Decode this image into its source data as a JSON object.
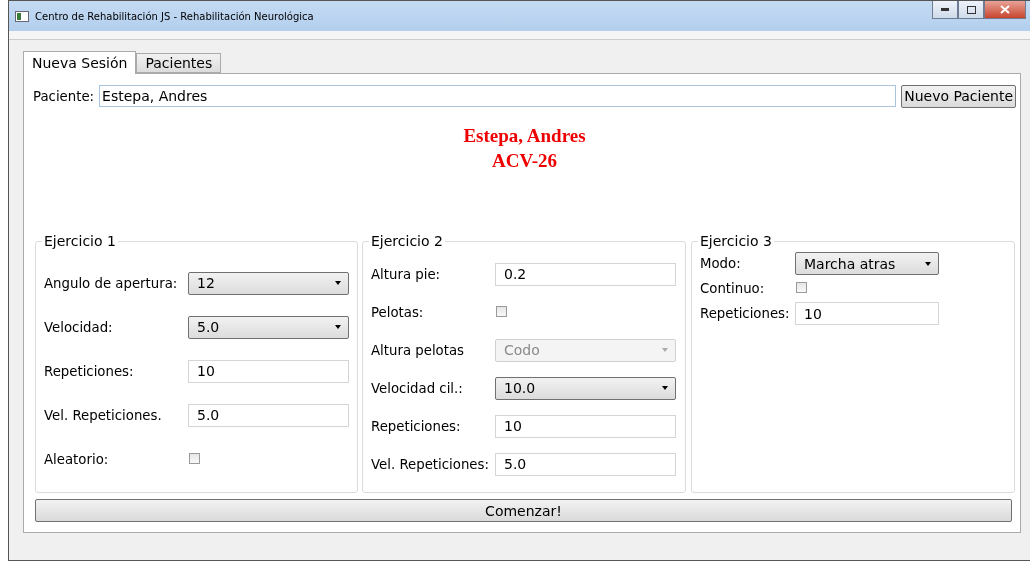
{
  "window": {
    "title": "Centro de Rehabilitación JS - Rehabilitación Neurológica"
  },
  "tabs": [
    {
      "label": "Nueva Sesión",
      "selected": true
    },
    {
      "label": "Pacientes",
      "selected": false
    }
  ],
  "patient": {
    "label": "Paciente:",
    "value": "Estepa, Andres",
    "button": "Nuevo Paciente"
  },
  "header": {
    "name": "Estepa, Andres",
    "diagnosis": "ACV-26"
  },
  "groups": [
    {
      "title": "Ejercicio 1",
      "fields": [
        {
          "kind": "combo",
          "label": "Angulo de apertura:",
          "value": "12",
          "disabled": false
        },
        {
          "kind": "combo",
          "label": "Velocidad:",
          "value": "5.0",
          "disabled": false
        },
        {
          "kind": "text",
          "label": "Repeticiones:",
          "value": "10"
        },
        {
          "kind": "text",
          "label": "Vel. Repeticiones.",
          "value": "5.0"
        },
        {
          "kind": "check",
          "label": "Aleatorio:",
          "checked": false
        }
      ]
    },
    {
      "title": "Ejercicio 2",
      "fields": [
        {
          "kind": "text",
          "label": "Altura pie:",
          "value": "0.2"
        },
        {
          "kind": "check",
          "label": "Pelotas:",
          "checked": false
        },
        {
          "kind": "combo",
          "label": "Altura pelotas",
          "value": "Codo",
          "disabled": true
        },
        {
          "kind": "combo",
          "label": "Velocidad cil.:",
          "value": "10.0",
          "disabled": false
        },
        {
          "kind": "text",
          "label": "Repeticiones:",
          "value": "10"
        },
        {
          "kind": "text",
          "label": "Vel. Repeticiones:",
          "value": "5.0"
        }
      ]
    },
    {
      "title": "Ejercicio 3",
      "fields": [
        {
          "kind": "combo",
          "label": "Modo:",
          "value": "Marcha atras",
          "disabled": false
        },
        {
          "kind": "check",
          "label": "Continuo:",
          "checked": false
        },
        {
          "kind": "text",
          "label": "Repeticiones:",
          "value": "10"
        }
      ]
    }
  ],
  "start_button": "Comenzar!"
}
